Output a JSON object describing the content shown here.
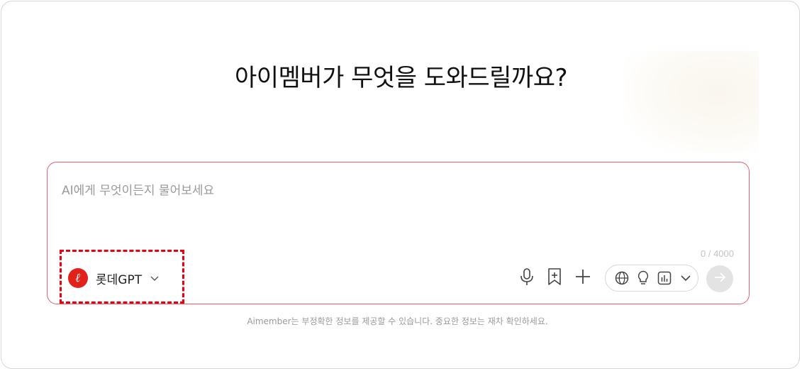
{
  "heading": "아이멤버가 무엇을 도와드릴까요?",
  "composer": {
    "placeholder": "AI에게 무엇이든지 물어보세요",
    "char_counter": "0 / 4000"
  },
  "model_selector": {
    "logo_letter": "ℓ",
    "label": "롯데GPT",
    "brand_color": "#e3211b"
  },
  "toolbar": {
    "icons": [
      "microphone-icon",
      "bookmark-add-icon",
      "plus-icon",
      "globe-icon",
      "lightbulb-icon",
      "chart-icon",
      "chevron-down-icon",
      "arrow-right-icon"
    ]
  },
  "disclaimer": "Aimember는 부정확한 정보를 제공할 수 있습니다. 중요한 정보는 재차 확인하세요.",
  "colors": {
    "accent": "#e8606a",
    "highlight": "#e60012"
  }
}
